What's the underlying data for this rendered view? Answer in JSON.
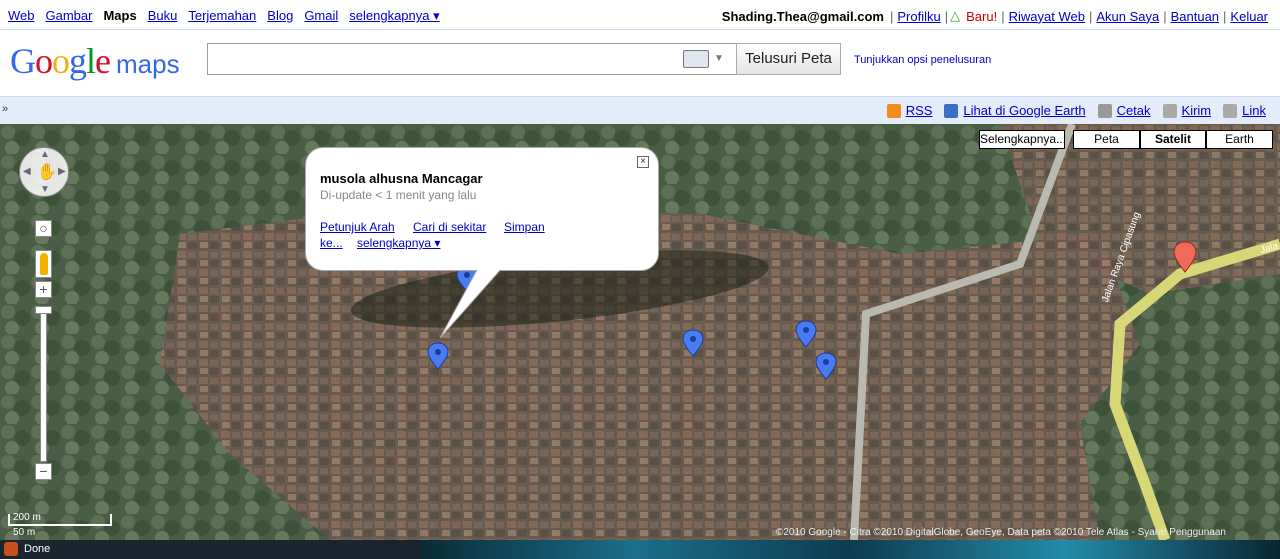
{
  "topbar": {
    "links": [
      "Web",
      "Gambar",
      "Maps",
      "Buku",
      "Terjemahan",
      "Blog",
      "Gmail",
      "selengkapnya ▾"
    ],
    "current": "Maps",
    "email": "Shading.Thea@gmail.com",
    "profile": "Profilku",
    "new": "Baru!",
    "history": "Riwayat Web",
    "account": "Akun Saya",
    "help": "Bantuan",
    "logout": "Keluar"
  },
  "header": {
    "logo_google": "Google",
    "logo_maps": "maps",
    "search_value": "",
    "search_button": "Telusuri Peta",
    "options_link": "Tunjukkan opsi penelusuran"
  },
  "linkbar": {
    "collapse": "»",
    "items": [
      {
        "label": "RSS",
        "icon": "rss-icon",
        "color": "#f28c1c"
      },
      {
        "label": "Lihat di Google Earth",
        "icon": "earth-icon",
        "color": "#3a70c4"
      },
      {
        "label": "Cetak",
        "icon": "print-icon",
        "color": "#888888"
      },
      {
        "label": "Kirim",
        "icon": "mail-icon",
        "color": "#888888"
      },
      {
        "label": "Link",
        "icon": "link-icon",
        "color": "#888888"
      }
    ]
  },
  "map": {
    "type_buttons": {
      "more": "Selengkapnya...",
      "peta": "Peta",
      "satelit": "Satelit",
      "earth": "Earth"
    },
    "active_type": "Satelit",
    "road_label_1": "Jalan Raya Cipasung",
    "road_label_2": "Jala",
    "scale_top": "200 m",
    "scale_bottom": "50 m",
    "copyright": "©2010 Google - Citra ©2010 DigitalGlobe, GeoEye, Data peta ©2010 Tele Atlas - Syarat Penggunaan"
  },
  "bubble": {
    "title": "musola alhusna Mancagar",
    "subtitle": "Di-update < 1 menit yang lalu",
    "link_directions": "Petunjuk Arah",
    "link_nearby": "Cari di sekitar",
    "link_save": "Simpan",
    "link_save_cont": "ke...",
    "link_more": "selengkapnya ▾",
    "close": "×"
  },
  "status": {
    "text": "Done"
  }
}
